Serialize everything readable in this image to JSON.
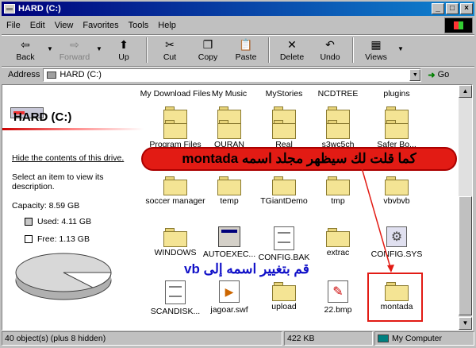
{
  "window": {
    "title": "HARD (C:)"
  },
  "menu": [
    "File",
    "Edit",
    "View",
    "Favorites",
    "Tools",
    "Help"
  ],
  "toolbar": {
    "back": "Back",
    "forward": "Forward",
    "up": "Up",
    "cut": "Cut",
    "copy": "Copy",
    "paste": "Paste",
    "delete": "Delete",
    "undo": "Undo",
    "views": "Views"
  },
  "address": {
    "label": "Address",
    "value": "HARD (C:)",
    "go": "Go"
  },
  "left_panel": {
    "title": "HARD (C:)",
    "hide_link": "Hide the contents of this drive.",
    "select_text": "Select an item to view its description.",
    "capacity": "Capacity: 8.59 GB",
    "used": "Used: 4.11 GB",
    "free": "Free: 1.13 GB"
  },
  "items": [
    {
      "label": "My Download Files"
    },
    {
      "label": "My Music"
    },
    {
      "label": "MyStories"
    },
    {
      "label": "NCDTREE"
    },
    {
      "label": "plugins"
    },
    {
      "label": "Program Files"
    },
    {
      "label": "QURAN"
    },
    {
      "label": "Real"
    },
    {
      "label": "s3wc5ch"
    },
    {
      "label": "Safer Bo..."
    },
    {
      "label": "soccer manager"
    },
    {
      "label": "temp"
    },
    {
      "label": "TGiantDemo"
    },
    {
      "label": "tmp"
    },
    {
      "label": "vbvbvb"
    },
    {
      "label": "WINDOWS"
    },
    {
      "label": "AUTOEXEC..."
    },
    {
      "label": "CONFIG.BAK"
    },
    {
      "label": "extrac"
    },
    {
      "label": "CONFIG.SYS"
    },
    {
      "label": "SCANDISK..."
    },
    {
      "label": "jagoar.swf"
    },
    {
      "label": "upload"
    },
    {
      "label": "22.bmp"
    },
    {
      "label": "montada"
    }
  ],
  "annotations": {
    "top": "كما قلت لك سيظهر مجلد اسمه montada",
    "bottom": "قم بتغيير اسمه إلى vb"
  },
  "colors": {
    "annotation_red": "#e21b14",
    "annotation_blue": "#1010c8",
    "title_bar": "#00007b"
  },
  "status": {
    "objects": "40 object(s) (plus 8 hidden)",
    "size": "422 KB",
    "location": "My Computer"
  }
}
